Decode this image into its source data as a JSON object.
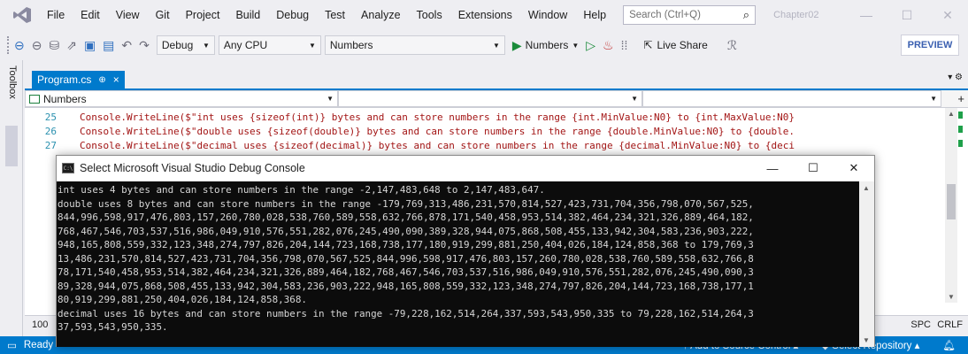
{
  "menu": {
    "items": [
      "File",
      "Edit",
      "View",
      "Git",
      "Project",
      "Build",
      "Debug",
      "Test",
      "Analyze",
      "Tools",
      "Extensions",
      "Window",
      "Help"
    ],
    "search_placeholder": "Search (Ctrl+Q)",
    "solution_name": "Chapter02"
  },
  "toolbar": {
    "configuration": "Debug",
    "platform": "Any CPU",
    "startup_project": "Numbers",
    "run_target": "Numbers",
    "live_share": "Live Share",
    "preview": "PREVIEW"
  },
  "toolbox": {
    "label": "Toolbox"
  },
  "editor": {
    "tab": {
      "name": "Program.cs",
      "pin": "⊕",
      "close": "×"
    },
    "nav_project": "Numbers",
    "lines": [
      {
        "num": "25",
        "text": "Console.WriteLine($\"int uses {sizeof(int)} bytes and can store numbers in the range {int.MinValue:N0} to {int.MaxValue:N0}"
      },
      {
        "num": "26",
        "text": "Console.WriteLine($\"double uses {sizeof(double)} bytes and can store numbers in the range {double.MinValue:N0} to {double."
      },
      {
        "num": "27",
        "text": "Console.WriteLine($\"decimal uses {sizeof(decimal)} bytes and can store numbers in the range {decimal.MinValue:N0} to {deci"
      }
    ],
    "zoom": "100",
    "spc": "SPC",
    "crlf": "CRLF"
  },
  "console": {
    "title": "Select Microsoft Visual Studio Debug Console",
    "lines": [
      "int uses 4 bytes and can store numbers in the range -2,147,483,648 to 2,147,483,647.",
      "double uses 8 bytes and can store numbers in the range -179,769,313,486,231,570,814,527,423,731,704,356,798,070,567,525,",
      "844,996,598,917,476,803,157,260,780,028,538,760,589,558,632,766,878,171,540,458,953,514,382,464,234,321,326,889,464,182,",
      "768,467,546,703,537,516,986,049,910,576,551,282,076,245,490,090,389,328,944,075,868,508,455,133,942,304,583,236,903,222,",
      "948,165,808,559,332,123,348,274,797,826,204,144,723,168,738,177,180,919,299,881,250,404,026,184,124,858,368 to 179,769,3",
      "13,486,231,570,814,527,423,731,704,356,798,070,567,525,844,996,598,917,476,803,157,260,780,028,538,760,589,558,632,766,8",
      "78,171,540,458,953,514,382,464,234,321,326,889,464,182,768,467,546,703,537,516,986,049,910,576,551,282,076,245,490,090,3",
      "89,328,944,075,868,508,455,133,942,304,583,236,903,222,948,165,808,559,332,123,348,274,797,826,204,144,723,168,738,177,1",
      "80,919,299,881,250,404,026,184,124,858,368.",
      "decimal uses 16 bytes and can store numbers in the range -79,228,162,514,264,337,593,543,950,335 to 79,228,162,514,264,3",
      "37,593,543,950,335."
    ]
  },
  "status": {
    "ready": "Ready",
    "source_control": "Add to Source Control",
    "repository": "Select Repository"
  }
}
